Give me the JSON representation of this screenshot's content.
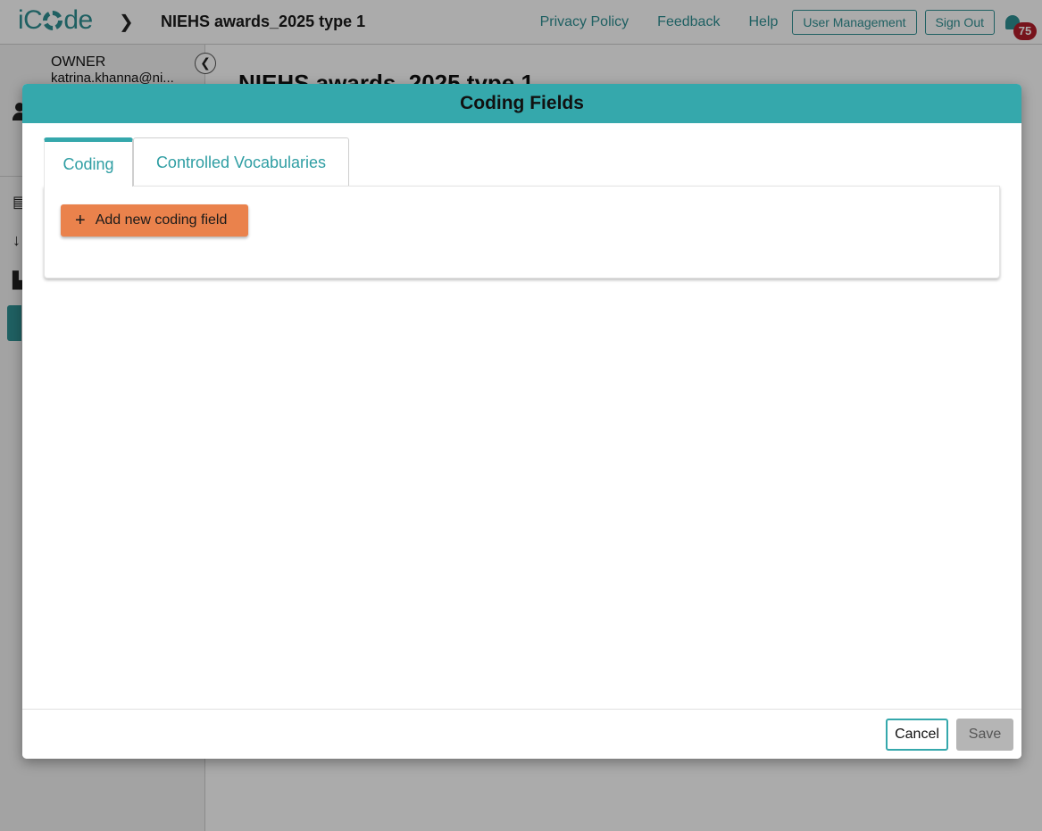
{
  "app": {
    "logo_text_left": "iC",
    "logo_text_right": "de",
    "project_title": "NIEHS awards_2025 type 1",
    "nav": {
      "privacy_policy": "Privacy Policy",
      "feedback": "Feedback",
      "help": "Help",
      "user_management": "User Management",
      "sign_out": "Sign Out",
      "notification_count": "75"
    },
    "sidebar": {
      "role": "OWNER",
      "email": "katrina.khanna@ni..."
    },
    "page_heading": "NIEHS awards_2025 type 1"
  },
  "modal": {
    "title": "Coding Fields",
    "tabs": [
      {
        "label": "Coding",
        "active": true
      },
      {
        "label": "Controlled Vocabularies",
        "active": false
      }
    ],
    "add_button_label": "Add new coding field",
    "cancel_label": "Cancel",
    "save_label": "Save"
  },
  "colors": {
    "accent": "#35a8ac",
    "action": "#ea824c",
    "badge": "#b21d2a",
    "disabled": "#b5b5b5"
  }
}
